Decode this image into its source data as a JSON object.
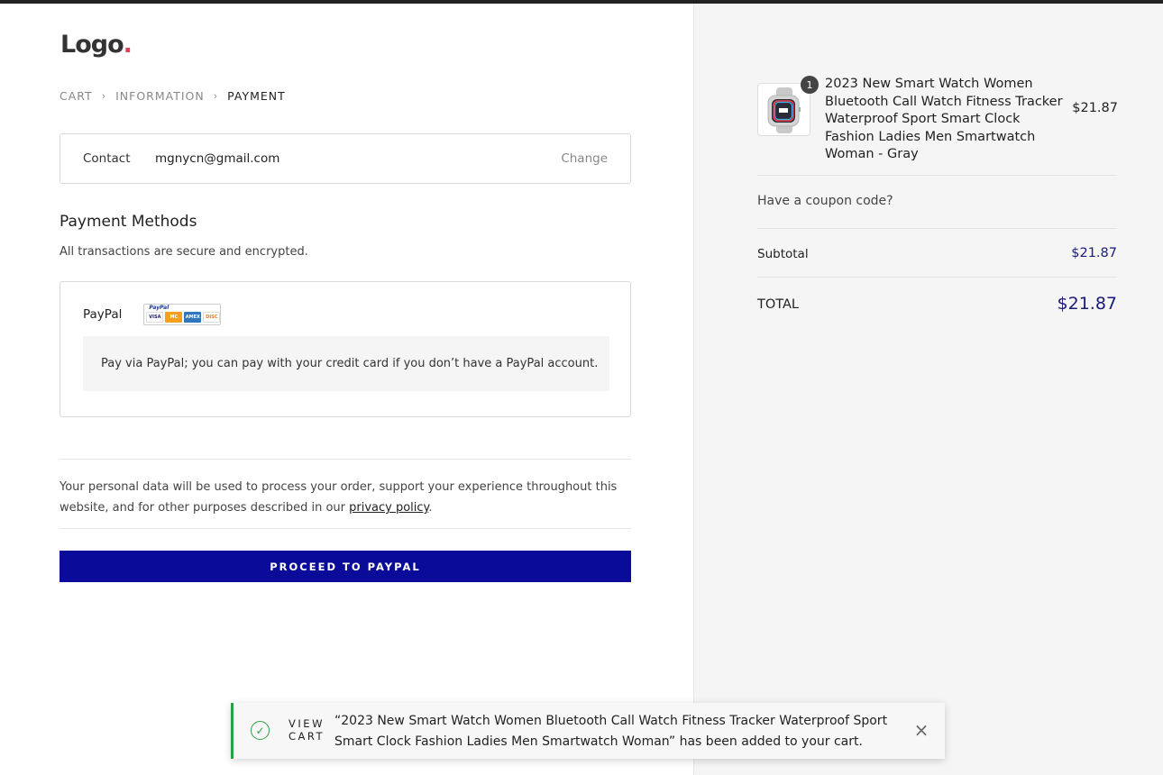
{
  "logo": {
    "text": "Logo",
    "dot": "."
  },
  "breadcrumb": [
    {
      "label": "CART"
    },
    {
      "label": "INFORMATION"
    },
    {
      "label": "PAYMENT"
    }
  ],
  "breadcrumb_separator": "›",
  "contact": {
    "label": "Contact",
    "email": "mgnycn@gmail.com",
    "change_label": "Change"
  },
  "payment": {
    "title": "Payment Methods",
    "subtitle": "All transactions are secure and encrypted.",
    "method_label": "PayPal",
    "badge_text": "PayPal",
    "cards": [
      "VISA",
      "MC",
      "AMEX",
      "DISC"
    ],
    "description": "Pay via PayPal; you can pay with your credit card if you don’t have a PayPal account."
  },
  "privacy": {
    "text": "Your personal data will be used to process your order, support your experience throughout this website, and for other purposes described in our ",
    "link": "privacy policy",
    "end": "."
  },
  "proceed_button": "PROCEED TO PAYPAL",
  "summary": {
    "product": {
      "quantity": "1",
      "name": "2023 New Smart Watch Women Bluetooth Call Watch Fitness Tracker Waterproof Sport Smart Clock Fashion Ladies Men Smartwatch Woman - Gray",
      "price": "$21.87"
    },
    "coupon_label": "Have a coupon code?",
    "subtotal_label": "Subtotal",
    "subtotal_value": "$21.87",
    "total_label": "TOTAL",
    "total_value": "$21.87"
  },
  "toast": {
    "view_cart_line1": "VIEW",
    "view_cart_line2": "CART",
    "message": "“2023 New Smart Watch Women Bluetooth Call Watch Fitness Tracker Waterproof Sport Smart Clock Fashion Ladies Men Smartwatch Woman” has been added to your cart.",
    "close_glyph": "×"
  },
  "colors": {
    "accent": "#0b0b99",
    "price": "#1a1a7a",
    "success": "#2e9e45",
    "logo_dot": "#e0405a"
  }
}
